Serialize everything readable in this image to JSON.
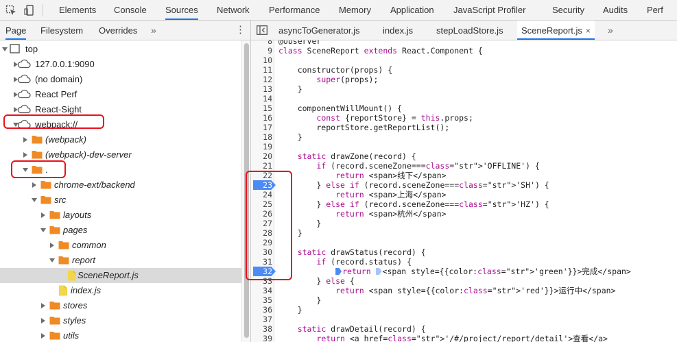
{
  "toolbar": {
    "tabs": [
      "Elements",
      "Console",
      "Sources",
      "Network",
      "Performance",
      "Memory",
      "Application",
      "JavaScript Profiler",
      "Security",
      "Audits",
      "Perf"
    ],
    "active_tab": "Sources"
  },
  "navigator": {
    "tabs": [
      "Page",
      "Filesystem",
      "Overrides"
    ],
    "more": "»",
    "menu": "⋮",
    "tree": [
      {
        "label": "top",
        "depth": 0,
        "expanded": true,
        "icon": "frame-icon",
        "italic": false
      },
      {
        "label": "127.0.0.1:9090",
        "depth": 1,
        "expanded": false,
        "icon": "cloud-icon",
        "italic": false
      },
      {
        "label": "(no domain)",
        "depth": 1,
        "expanded": false,
        "icon": "cloud-icon",
        "italic": false
      },
      {
        "label": "React Perf",
        "depth": 1,
        "expanded": false,
        "icon": "cloud-icon",
        "italic": false
      },
      {
        "label": "React-Sight",
        "depth": 1,
        "expanded": false,
        "icon": "cloud-icon",
        "italic": false
      },
      {
        "label": "webpack://",
        "depth": 1,
        "expanded": true,
        "icon": "cloud-icon",
        "italic": false
      },
      {
        "label": "(webpack)",
        "depth": 2,
        "expanded": false,
        "icon": "folder-icon",
        "italic": true
      },
      {
        "label": "(webpack)-dev-server",
        "depth": 2,
        "expanded": false,
        "icon": "folder-icon",
        "italic": true
      },
      {
        "label": ".",
        "depth": 2,
        "expanded": true,
        "icon": "folder-icon",
        "italic": false
      },
      {
        "label": "chrome-ext/backend",
        "depth": 3,
        "expanded": false,
        "icon": "folder-icon",
        "italic": true
      },
      {
        "label": "src",
        "depth": 3,
        "expanded": true,
        "icon": "folder-icon",
        "italic": true
      },
      {
        "label": "layouts",
        "depth": 4,
        "expanded": false,
        "icon": "folder-icon",
        "italic": true
      },
      {
        "label": "pages",
        "depth": 4,
        "expanded": true,
        "icon": "folder-icon",
        "italic": true
      },
      {
        "label": "common",
        "depth": 5,
        "expanded": false,
        "icon": "folder-icon",
        "italic": true
      },
      {
        "label": "report",
        "depth": 5,
        "expanded": true,
        "icon": "folder-icon",
        "italic": true
      },
      {
        "label": "SceneReport.js",
        "depth": 6,
        "expanded": null,
        "icon": "file-icon",
        "italic": true,
        "selected": true
      },
      {
        "label": "index.js",
        "depth": 5,
        "expanded": null,
        "icon": "file-icon",
        "italic": true
      },
      {
        "label": "stores",
        "depth": 4,
        "expanded": false,
        "icon": "folder-icon",
        "italic": true
      },
      {
        "label": "styles",
        "depth": 4,
        "expanded": false,
        "icon": "folder-icon",
        "italic": true
      },
      {
        "label": "utils",
        "depth": 4,
        "expanded": false,
        "icon": "folder-icon",
        "italic": true
      }
    ]
  },
  "editor": {
    "tabs": [
      "asyncToGenerator.js",
      "index.js",
      "stepLoadStore.js",
      "SceneReport.js"
    ],
    "active_tab": "SceneReport.js",
    "close": "×",
    "more": "»",
    "breakpoints": [
      23,
      32
    ],
    "paused_line": 32,
    "lines": [
      {
        "n": "8",
        "code": "@observer"
      },
      {
        "n": "9",
        "code": "class SceneReport extends React.Component {"
      },
      {
        "n": "10",
        "code": ""
      },
      {
        "n": "11",
        "code": "    constructor(props) {"
      },
      {
        "n": "12",
        "code": "        super(props);"
      },
      {
        "n": "13",
        "code": "    }"
      },
      {
        "n": "14",
        "code": ""
      },
      {
        "n": "15",
        "code": "    componentWillMount() {"
      },
      {
        "n": "16",
        "code": "        const {reportStore} = this.props;"
      },
      {
        "n": "17",
        "code": "        reportStore.getReportList();"
      },
      {
        "n": "18",
        "code": "    }"
      },
      {
        "n": "19",
        "code": ""
      },
      {
        "n": "20",
        "code": "    static drawZone(record) {"
      },
      {
        "n": "21",
        "code": "        if (record.sceneZone==='OFFLINE') {"
      },
      {
        "n": "22",
        "code": "            return <span>线下</span>"
      },
      {
        "n": "23",
        "code": "        } else if (record.sceneZone==='SH') {"
      },
      {
        "n": "24",
        "code": "            return <span>上海</span>"
      },
      {
        "n": "25",
        "code": "        } else if (record.sceneZone==='HZ') {"
      },
      {
        "n": "26",
        "code": "            return <span>杭州</span>"
      },
      {
        "n": "27",
        "code": "        }"
      },
      {
        "n": "28",
        "code": "    }"
      },
      {
        "n": "29",
        "code": ""
      },
      {
        "n": "30",
        "code": "    static drawStatus(record) {"
      },
      {
        "n": "31",
        "code": "        if (record.status) {"
      },
      {
        "n": "32",
        "code": "            return <span style={{color:'green'}}>完成</span>"
      },
      {
        "n": "33",
        "code": "        } else {"
      },
      {
        "n": "34",
        "code": "            return <span style={{color:'red'}}>运行中</span>"
      },
      {
        "n": "35",
        "code": "        }"
      },
      {
        "n": "36",
        "code": "    }"
      },
      {
        "n": "37",
        "code": ""
      },
      {
        "n": "38",
        "code": "    static drawDetail(record) {"
      },
      {
        "n": "39",
        "code": "        return <a href='/#/project/report/detail'>查看</a>"
      }
    ]
  },
  "colors": {
    "accent": "#1a73e8",
    "breakpoint": "#4c8bf5",
    "annotation": "#e8111a",
    "folder": "#f08a24",
    "file": "#f2d64b"
  }
}
